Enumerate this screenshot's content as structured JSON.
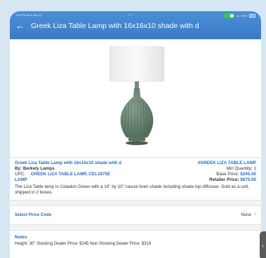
{
  "status": {
    "time": "1:10 PM  Mon Mar 11",
    "dots": "•••",
    "right": "● ≈ 62%"
  },
  "header": {
    "back_icon": "←",
    "title": "Greek Liza Table Lamp with 16x16x10 shade with d"
  },
  "product": {
    "name": "Greek Liza Table Lamp with 16x16x10 shade with d",
    "sku": "#GREEK LIZA TABLE LAMP",
    "by_label": "By: Berkely Lamps",
    "min_qty": "Min Quantity: 1",
    "upc_label": "UPC:",
    "upc_value": "GREEK LIZA TABLE LAMP, CEL1875E",
    "upc_value_2": "LAMP",
    "base_price_label": "Base Price:",
    "base_price": "$245.00",
    "retail_price_label": "Retailer Price:",
    "retail_price": "$675.00",
    "description": "The Liza Table lamp in Celadon Green with a 16\" by 10\" casusl linen shade including shade top diffusser. Sold as a unit, shipped in 2 boxes."
  },
  "price_code": {
    "label": "Select Price Code",
    "value": "None",
    "chevron": "›"
  },
  "notes": {
    "heading": "Notes",
    "text": "Height: 30\" Stocking Dealer Price: $245 Non Stocking Dealer Price: $319"
  },
  "side_handle": "‹",
  "colors": {
    "header": "#3a7bc8",
    "link": "#2a6cc0",
    "background": "#d6e6f3",
    "lamp_body": "#6b8a72"
  }
}
